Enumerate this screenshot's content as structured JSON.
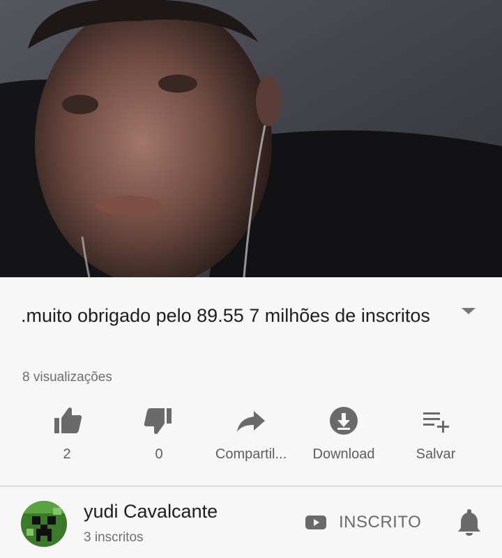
{
  "video": {
    "thumbnail": "video-frame"
  },
  "details": {
    "title": ".muito obrigado pelo 89.55 7 milhões  de inscritos",
    "views": "8 visualizações"
  },
  "actions": [
    {
      "icon": "thumb-up-icon",
      "label": "2"
    },
    {
      "icon": "thumb-down-icon",
      "label": "0"
    },
    {
      "icon": "share-icon",
      "label": "Compartil..."
    },
    {
      "icon": "download-icon",
      "label": "Download"
    },
    {
      "icon": "playlist-add-icon",
      "label": "Salvar"
    }
  ],
  "channel": {
    "name": "yudi Cavalcante",
    "subscribers": "3 inscritos",
    "subscribed_label": "INSCRITO",
    "avatar_icon": "creeper-avatar-icon",
    "bell_icon": "bell-icon"
  },
  "colors": {
    "background": "#f7f7f7",
    "icon_gray": "#6a6a6a",
    "avatar_green": "#3b7a2a"
  }
}
